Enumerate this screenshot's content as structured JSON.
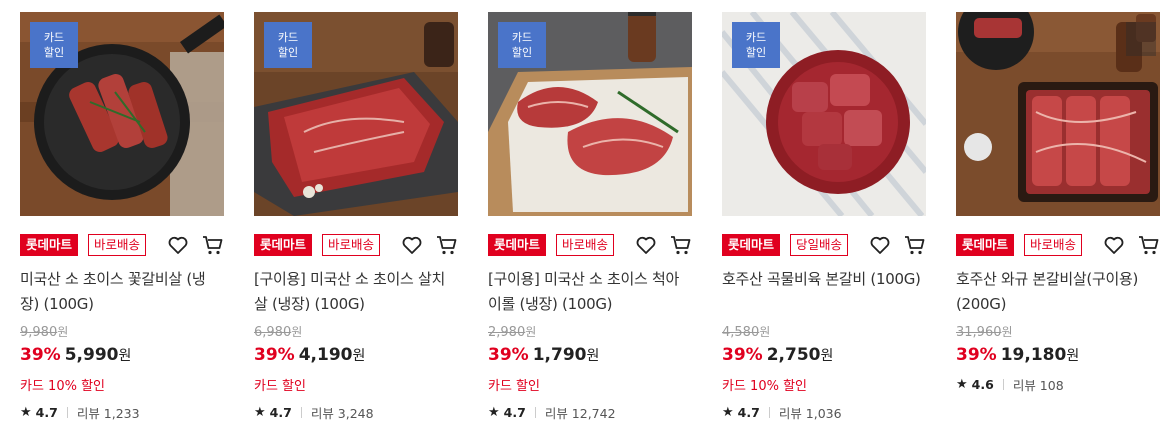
{
  "products": [
    {
      "badge": [
        "카드",
        "할인"
      ],
      "mart": "롯데마트",
      "ship": "바로배송",
      "name": "미국산 소 초이스 꽃갈비살 (냉장) (100G)",
      "original_price": "9,980",
      "original_unit": "원",
      "discount": "39%",
      "sale_price": "5,990",
      "sale_unit": "원",
      "promo": "카드 10% 할인",
      "rating": "4.7",
      "reviews": "리뷰 1,233",
      "image": "steak-in-cast-iron-pan"
    },
    {
      "badge": [
        "카드",
        "할인"
      ],
      "mart": "롯데마트",
      "ship": "바로배송",
      "name": "[구이용] 미국산 소 초이스 살치살 (냉장) (100G)",
      "original_price": "6,980",
      "original_unit": "원",
      "discount": "39%",
      "sale_price": "4,190",
      "sale_unit": "원",
      "promo": "카드 할인",
      "rating": "4.7",
      "reviews": "리뷰 3,248",
      "image": "beef-on-slate-board"
    },
    {
      "badge": [
        "카드",
        "할인"
      ],
      "mart": "롯데마트",
      "ship": "바로배송",
      "name": "[구이용] 미국산 소 초이스 척아이롤 (냉장) (100G)",
      "original_price": "2,980",
      "original_unit": "원",
      "discount": "39%",
      "sale_price": "1,790",
      "sale_unit": "원",
      "promo": "카드 할인",
      "rating": "4.7",
      "reviews": "리뷰 12,742",
      "image": "steaks-on-paper"
    },
    {
      "badge": [
        "카드",
        "할인"
      ],
      "mart": "롯데마트",
      "ship": "당일배송",
      "name": "호주산 곡물비육 본갈비 (100G)",
      "original_price": "4,580",
      "original_unit": "원",
      "discount": "39%",
      "sale_price": "2,750",
      "sale_unit": "원",
      "promo": "카드 10% 할인",
      "rating": "4.7",
      "reviews": "리뷰 1,036",
      "image": "short-ribs-in-red-bowl"
    },
    {
      "badge": [],
      "mart": "롯데마트",
      "ship": "바로배송",
      "name": "호주산 와규 본갈비살(구이용) (200G)",
      "original_price": "31,960",
      "original_unit": "원",
      "discount": "39%",
      "sale_price": "19,180",
      "sale_unit": "원",
      "promo": "",
      "rating": "4.6",
      "reviews": "리뷰 108",
      "image": "wagyu-in-tray"
    }
  ],
  "icons": {
    "wishlist": "heart-outline-icon",
    "cart": "cart-icon",
    "star": "star-icon"
  },
  "colors": {
    "accent": "#e0001f",
    "badge": "#4a74c9"
  }
}
